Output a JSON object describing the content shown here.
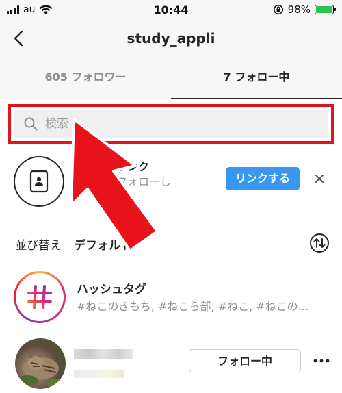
{
  "status_bar": {
    "carrier": "au",
    "time": "10:44",
    "battery_percent": "98%",
    "battery_level": 0.98
  },
  "nav": {
    "title": "study_appli"
  },
  "tabs": [
    {
      "label": "605 フォロワー",
      "active": false
    },
    {
      "label": "7 フォロー中",
      "active": true
    }
  ],
  "search": {
    "placeholder": "検索",
    "value": ""
  },
  "contacts": {
    "title": "をリンク",
    "subtitle": "をフォローし",
    "link_button": "リンクする"
  },
  "sort": {
    "label": "並び替え",
    "value": "デフォルト"
  },
  "hashtags": {
    "title": "ハッシュタグ",
    "subtitle": "#ねこのきもち, #ねこら部, #ねこ, #ねこの..."
  },
  "user": {
    "follow_button": "フォロー中"
  },
  "colors": {
    "accent_blue": "#3897f0",
    "highlight_red": "#e0141c",
    "text_dark": "#262626",
    "text_gray": "#8e8e8e"
  }
}
